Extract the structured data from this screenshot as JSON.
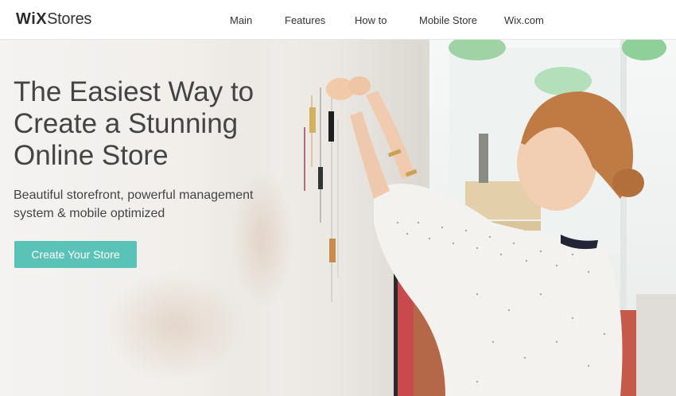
{
  "header": {
    "logo_bold": "WiX",
    "logo_light": "Stores",
    "nav": [
      {
        "label": "Main"
      },
      {
        "label": "Features"
      },
      {
        "label": "How to"
      },
      {
        "label": "Mobile Store"
      },
      {
        "label": "Wix.com"
      }
    ]
  },
  "hero": {
    "title": "The Easiest Way to Create a Stunning Online Store",
    "subtitle": "Beautiful storefront, powerful management system & mobile optimized",
    "cta_label": "Create Your Store",
    "image_description": ""
  },
  "colors": {
    "accent": "#5bc2b8",
    "text": "#444444",
    "header_bg": "#ffffff"
  }
}
